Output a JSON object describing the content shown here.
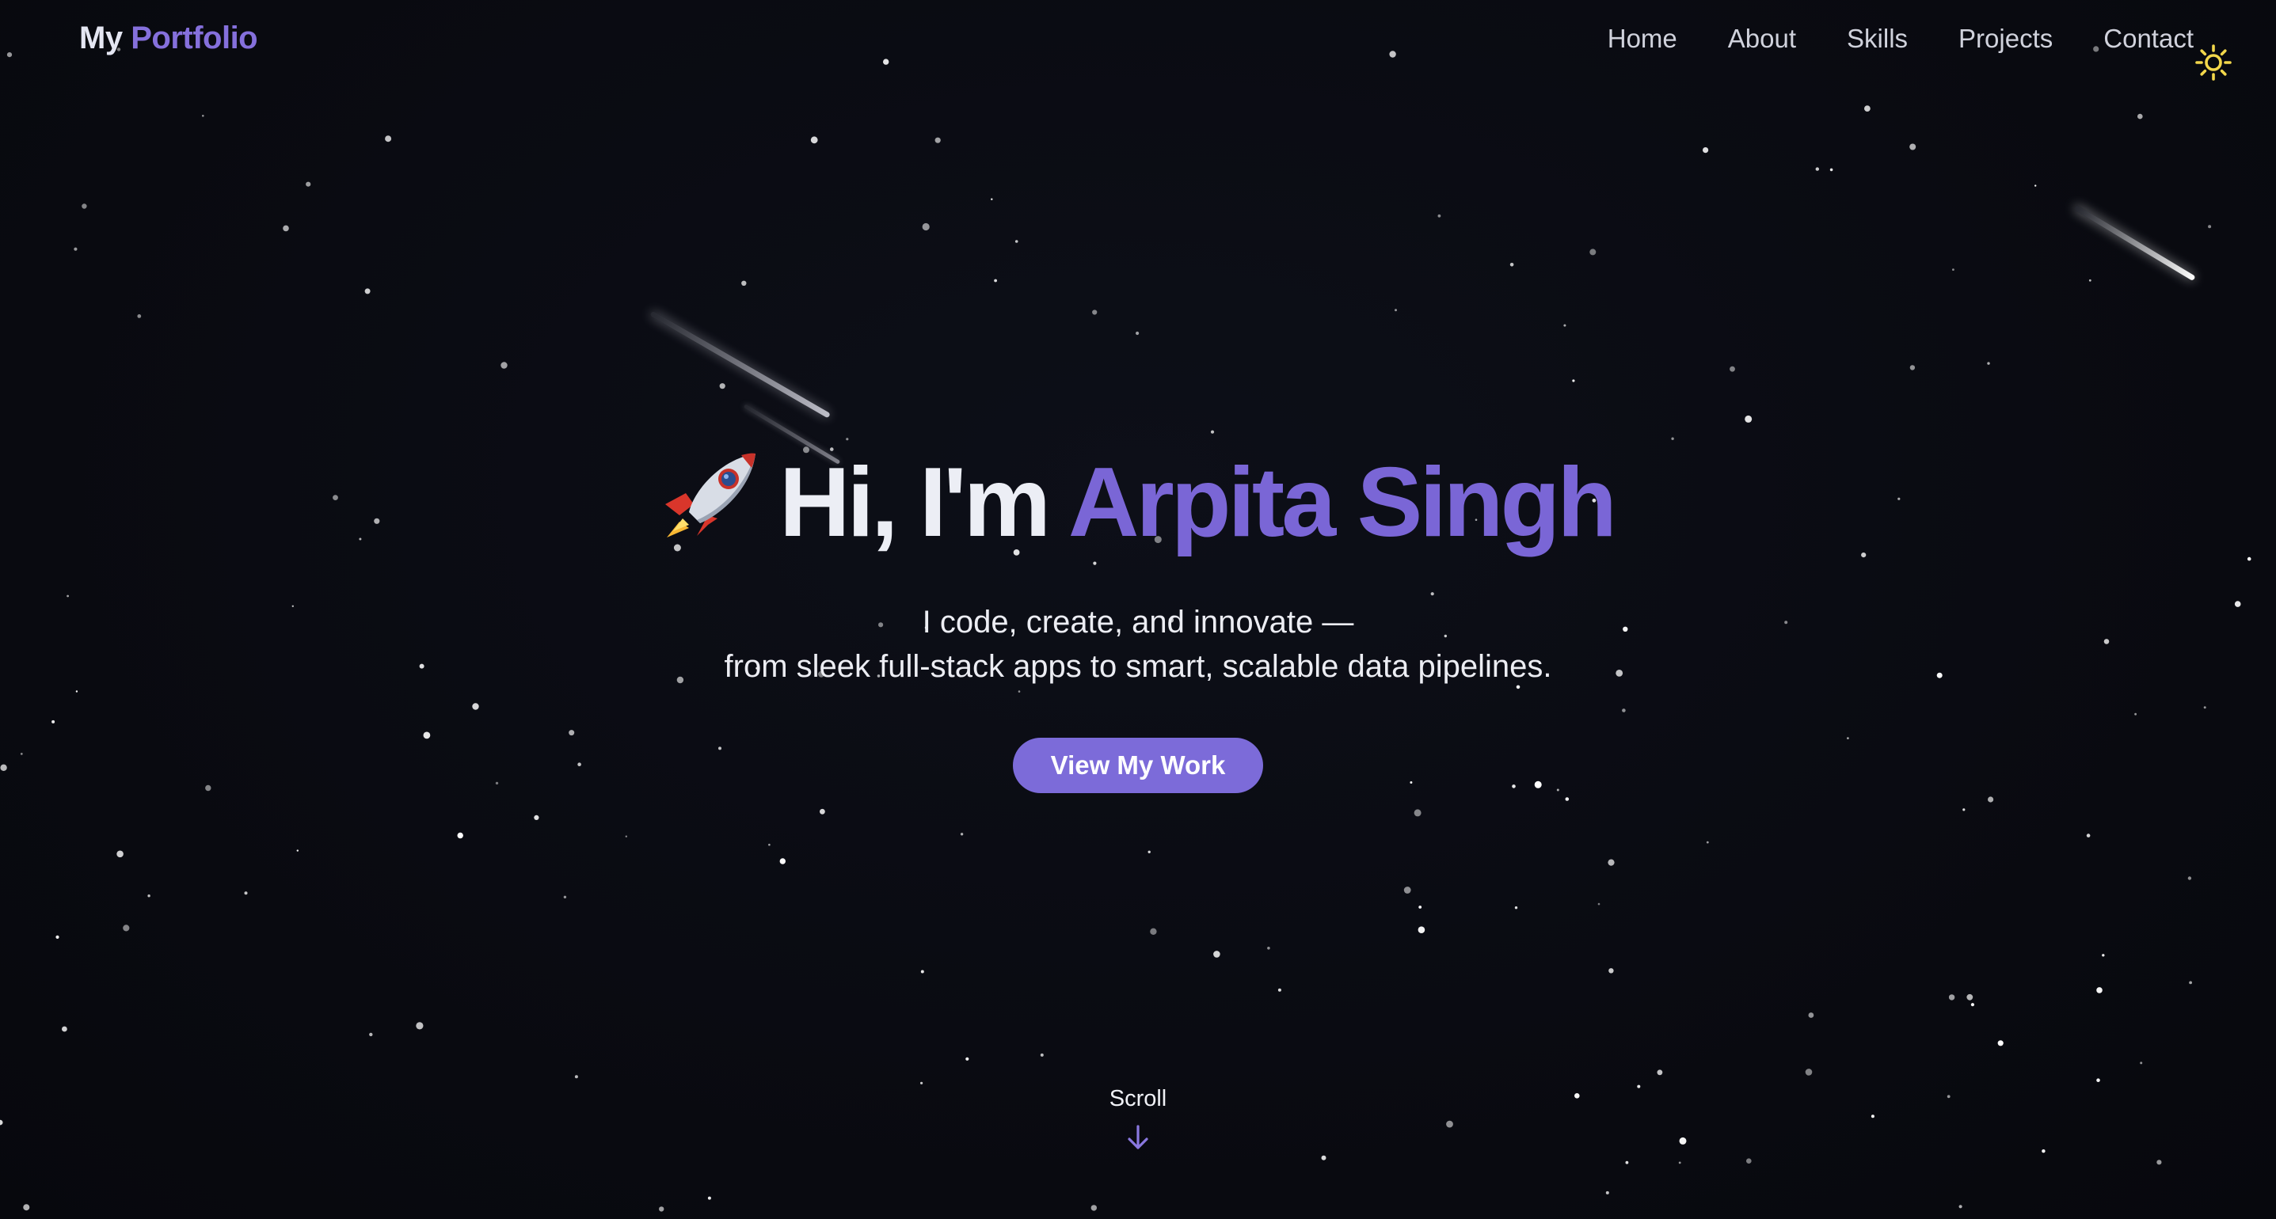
{
  "nav": {
    "logo_part1": "My",
    "logo_part2": "Portfolio",
    "items": [
      {
        "label": "Home"
      },
      {
        "label": "About"
      },
      {
        "label": "Skills"
      },
      {
        "label": "Projects"
      },
      {
        "label": "Contact"
      }
    ],
    "theme_toggle_icon": "sun-icon"
  },
  "hero": {
    "icon": "rocket-icon",
    "greeting": "Hi, I'm",
    "name": "Arpita Singh",
    "tagline_line1": "I code, create, and innovate —",
    "tagline_line2": "from sleek full-stack apps to smart, scalable data pipelines.",
    "cta_label": "View My Work"
  },
  "scroll": {
    "label": "Scroll",
    "icon": "arrow-down-icon"
  },
  "colors": {
    "background": "#0a0b12",
    "accent": "#7c6bd9",
    "sun": "#f2d74b"
  }
}
